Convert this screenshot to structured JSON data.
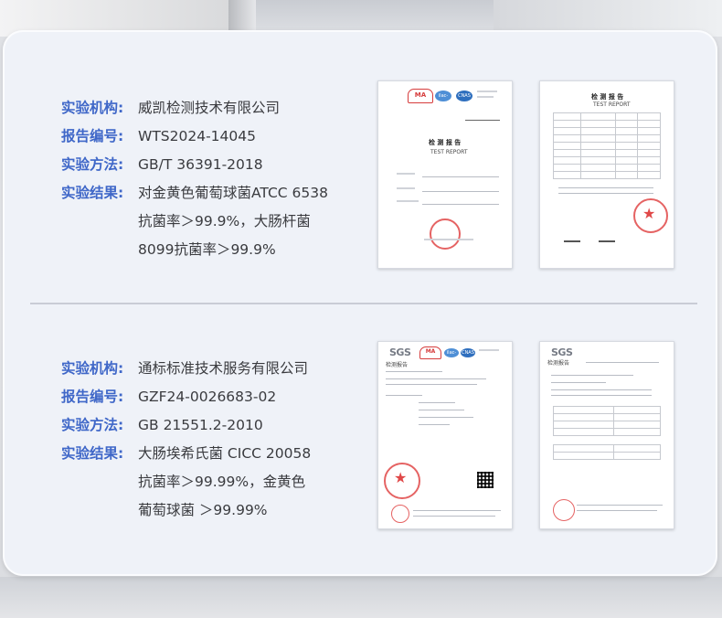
{
  "section1": {
    "institution_label": "实验机构:",
    "institution": "威凯检测技术有限公司",
    "report_label": "报告编号:",
    "report_no": "WTS2024-14045",
    "method_label": "实验方法:",
    "method": "GB/T 36391-2018",
    "result_label": "实验结果:",
    "result_lines": [
      "对金黄色葡萄球菌ATCC 6538",
      "抗菌率＞99.9%，大肠杆菌",
      "8099抗菌率＞99.9%"
    ],
    "doc1": {
      "title": "检 测 报 告",
      "subtitle": "TEST REPORT",
      "logo_ma": "MA",
      "logo_ilac": "ilac-MRA",
      "logo_cnas": "CNAS"
    },
    "doc2": {
      "title": "检 测 报 告",
      "subtitle": "TEST REPORT"
    }
  },
  "section2": {
    "institution_label": "实验机构:",
    "institution": "通标标准技术服务有限公司",
    "report_label": "报告编号:",
    "report_no": "GZF24-0026683-02",
    "method_label": "实验方法:",
    "method": "GB 21551.2-2010",
    "result_label": "实验结果:",
    "result_lines": [
      "大肠埃希氏菌 CICC 20058",
      "抗菌率＞99.99%，金黄色",
      "葡萄球菌 ＞99.99%"
    ],
    "doc3": {
      "brand": "SGS",
      "title": "检测报告",
      "logo_ma": "MA",
      "logo_ilac": "ilac-MRA",
      "logo_cnas": "CNAS"
    },
    "doc4": {
      "brand": "SGS",
      "title": "检测报告"
    }
  },
  "colors": {
    "label_blue": "#3f67c8",
    "text": "#3a3b3f",
    "card_bg": "#eff2f8",
    "stamp_red": "#e04848"
  }
}
